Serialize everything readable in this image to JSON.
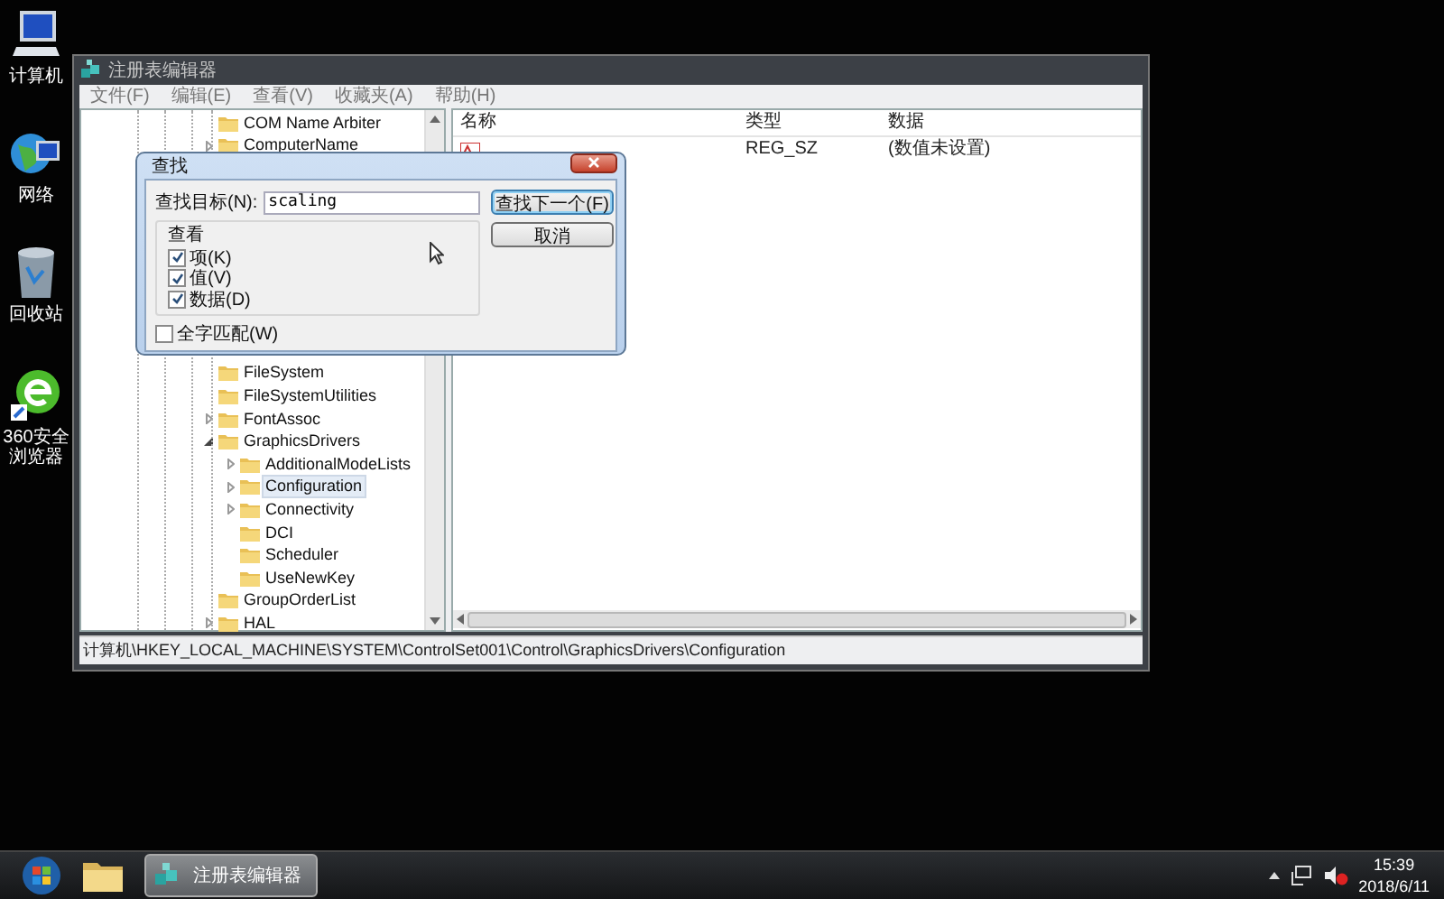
{
  "desktop_icons": [
    {
      "label": "计算机",
      "kind": "computer"
    },
    {
      "label": "网络",
      "kind": "network"
    },
    {
      "label": "回收站",
      "kind": "recycle"
    },
    {
      "label": "360安全浏览器",
      "kind": "browser"
    }
  ],
  "window": {
    "title": "注册表编辑器",
    "menu": [
      "文件(F)",
      "编辑(E)",
      "查看(V)",
      "收藏夹(A)",
      "帮助(H)"
    ],
    "tree": [
      {
        "label": "COM Name Arbiter",
        "expandable": false,
        "selected": false
      },
      {
        "label": "ComputerName",
        "expandable": true,
        "expanded": false,
        "selected": false
      },
      {
        "label": "FileSystem",
        "expandable": false,
        "selected": false
      },
      {
        "label": "FileSystemUtilities",
        "expandable": false,
        "selected": false
      },
      {
        "label": "FontAssoc",
        "expandable": true,
        "expanded": false,
        "selected": false
      },
      {
        "label": "GraphicsDrivers",
        "expandable": true,
        "expanded": true,
        "selected": false,
        "children": [
          {
            "label": "AdditionalModeLists",
            "expandable": true,
            "expanded": false,
            "selected": false
          },
          {
            "label": "Configuration",
            "expandable": true,
            "expanded": false,
            "selected": true
          },
          {
            "label": "Connectivity",
            "expandable": true,
            "expanded": false,
            "selected": false
          },
          {
            "label": "DCI",
            "expandable": false,
            "selected": false
          },
          {
            "label": "Scheduler",
            "expandable": false,
            "selected": false
          },
          {
            "label": "UseNewKey",
            "expandable": false,
            "selected": false
          }
        ]
      },
      {
        "label": "GroupOrderList",
        "expandable": false,
        "selected": false
      },
      {
        "label": "HAL",
        "expandable": true,
        "expanded": false,
        "selected": false
      }
    ],
    "columns": [
      "名称",
      "类型",
      "数据"
    ],
    "rows": [
      {
        "type": "REG_SZ",
        "data": "(数值未设置)"
      }
    ],
    "status_bar": "计算机\\HKEY_LOCAL_MACHINE\\SYSTEM\\ControlSet001\\Control\\GraphicsDrivers\\Configuration"
  },
  "dialog": {
    "title": "查找",
    "find_label": "查找目标(N):",
    "find_value": "scaling",
    "buttons": [
      {
        "label": "查找下一个(F)",
        "default": true
      },
      {
        "label": "取消",
        "default": false
      }
    ],
    "group_title": "查看",
    "options": [
      {
        "label": "项(K)",
        "checked": true
      },
      {
        "label": "值(V)",
        "checked": true
      },
      {
        "label": "数据(D)",
        "checked": true
      }
    ],
    "whole_word": {
      "label": "全字匹配(W)",
      "checked": false
    }
  },
  "taskbar": {
    "button": "注册表编辑器",
    "time": "15:39",
    "date": "2018/6/11"
  }
}
